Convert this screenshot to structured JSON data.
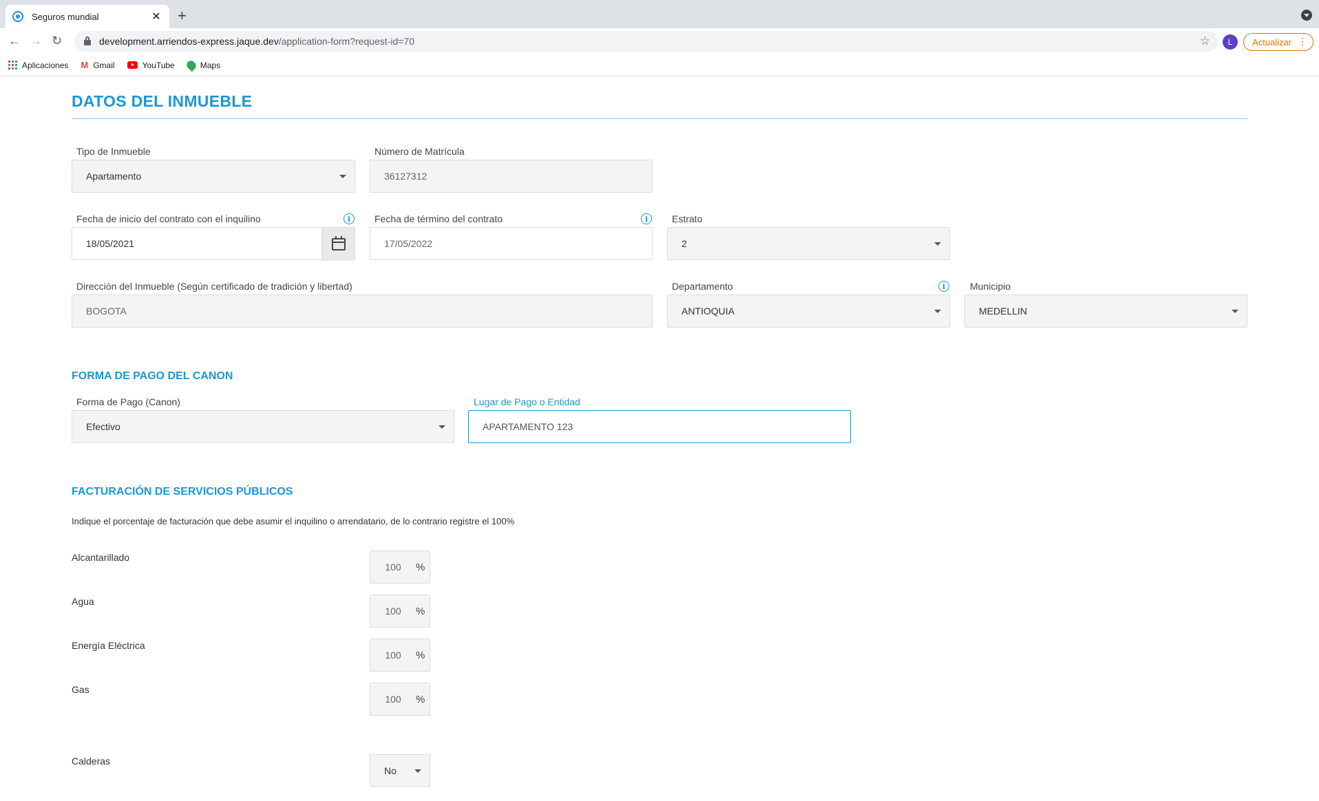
{
  "browser": {
    "tab_title": "Seguros mundial",
    "url_host": "development.arriendos-express.jaque.dev",
    "url_path": "/application-form?request-id=70",
    "avatar_letter": "L",
    "update_label": "Actualizar",
    "bookmarks": [
      {
        "label": "Aplicaciones",
        "icon": "apps-icon"
      },
      {
        "label": "Gmail",
        "icon": "gmail-icon"
      },
      {
        "label": "YouTube",
        "icon": "youtube-icon"
      },
      {
        "label": "Maps",
        "icon": "maps-icon"
      }
    ]
  },
  "form": {
    "section_title": "DATOS DEL INMUEBLE",
    "tipo_inmueble": {
      "label": "Tipo de Inmueble",
      "value": "Apartamento"
    },
    "matricula": {
      "label": "Número de Matrícula",
      "value": "36127312"
    },
    "fecha_inicio": {
      "label": "Fecha de inicio del contrato con el inquilino",
      "value": "18/05/2021"
    },
    "fecha_termino": {
      "label": "Fecha de término del contrato",
      "value": "17/05/2022"
    },
    "estrato": {
      "label": "Estrato",
      "value": "2"
    },
    "direccion": {
      "label": "Dirección del Inmueble (Según certificado de tradición y libertad)",
      "value": "BOGOTA"
    },
    "departamento": {
      "label": "Departamento",
      "value": "ANTIOQUIA"
    },
    "municipio": {
      "label": "Municipio",
      "value": "MEDELLIN"
    },
    "pago_title": "FORMA DE PAGO DEL CANON",
    "forma_pago": {
      "label": "Forma de Pago (Canon)",
      "value": "Efectivo"
    },
    "lugar_pago": {
      "label": "Lugar de Pago o Entidad",
      "value": "APARTAMENTO 123"
    },
    "facturacion_title": "FACTURACIÓN DE SERVICIOS PÚBLICOS",
    "facturacion_instructions": "Indique el porcentaje de facturación que debe asumir el inquilino o arrendatario, de lo contrario registre el 100%",
    "percent_symbol": "%",
    "utilities": [
      {
        "label": "Alcantarillado",
        "value": "100"
      },
      {
        "label": "Agua",
        "value": "100"
      },
      {
        "label": "Energía Eléctrica",
        "value": "100"
      },
      {
        "label": "Gas",
        "value": "100"
      }
    ],
    "calderas": {
      "label": "Calderas",
      "value": "No"
    }
  },
  "colors": {
    "accent": "#1a97d6",
    "update_orange": "#e37400"
  }
}
